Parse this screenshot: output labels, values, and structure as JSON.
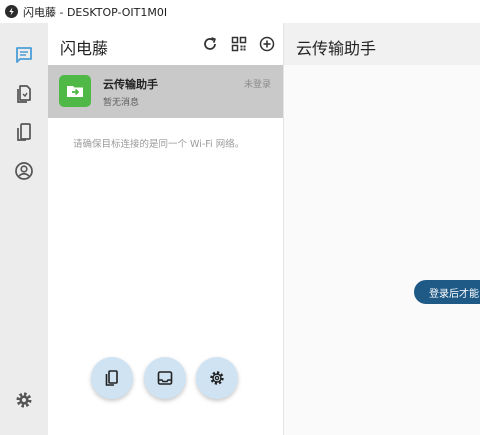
{
  "window": {
    "title": "闪电藤 - DESKTOP-OIT1M0I"
  },
  "sidebar": {
    "items": [
      {
        "name": "messages",
        "icon": "chat-icon",
        "active": true
      },
      {
        "name": "files",
        "icon": "file-icon",
        "active": false
      },
      {
        "name": "devices",
        "icon": "device-icon",
        "active": false
      },
      {
        "name": "account",
        "icon": "user-icon",
        "active": false
      }
    ],
    "settings_icon": "gear-icon"
  },
  "list": {
    "title": "闪电藤",
    "actions": [
      "refresh-icon",
      "qr-code-icon",
      "add-icon"
    ],
    "devices": [
      {
        "name": "云传输助手",
        "status": "未登录",
        "last_message": "暂无消息",
        "icon": "cloud-transfer-icon"
      }
    ],
    "hint": "请确保目标连接的是同一个 Wi-Fi 网络。"
  },
  "fabs": [
    "device-mirror-icon",
    "inbox-icon",
    "settings-icon"
  ],
  "chat": {
    "title": "云传输助手",
    "login_button": "登录后才能"
  },
  "colors": {
    "accent": "#4a9fd8",
    "sidebar_bg": "#ececec",
    "selected_row": "#c9c9c9",
    "device_green": "#4fb847",
    "login_button": "#1f5a87",
    "fab_bg": "#cfe3f3"
  }
}
